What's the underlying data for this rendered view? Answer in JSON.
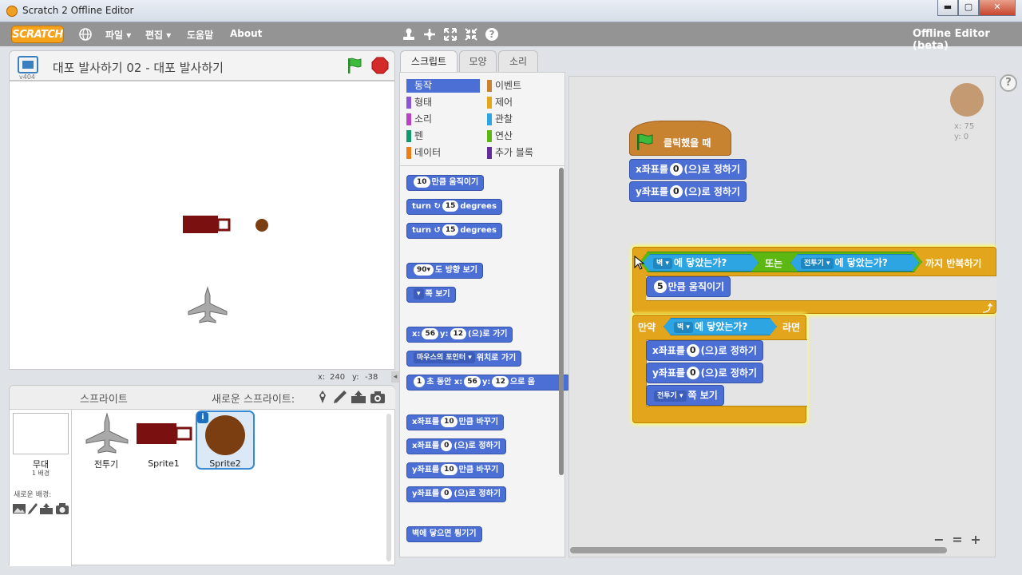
{
  "window": {
    "title": "Scratch 2 Offline Editor",
    "min": "▬",
    "max": "▢",
    "close": "✕"
  },
  "menu": {
    "logo": "SCRATCH",
    "file": "파일 ▾",
    "edit": "편집 ▾",
    "help": "도움말",
    "about": "About",
    "edition": "Offline Editor (beta)"
  },
  "stage": {
    "project_title": "대포 발사하기 02 - 대포 발사하기",
    "version": "v404",
    "mouse_x_label": "x:",
    "mouse_x": "240",
    "mouse_y_label": "y:",
    "mouse_y": "-38"
  },
  "tabs": {
    "scripts": "스크립트",
    "costumes": "모양",
    "sounds": "소리"
  },
  "categories": {
    "motion": "동작",
    "looks": "형태",
    "sound": "소리",
    "pen": "펜",
    "data": "데이터",
    "events": "이벤트",
    "control": "제어",
    "sensing": "관찰",
    "operators": "연산",
    "more": "추가 블록"
  },
  "palette": {
    "move": {
      "num": "10",
      "text": "만큼 움직이기"
    },
    "turn_cw": {
      "label": "turn",
      "icon": "↻",
      "num": "15",
      "unit": "degrees"
    },
    "turn_ccw": {
      "label": "turn",
      "icon": "↺",
      "num": "15",
      "unit": "degrees"
    },
    "point_dir": {
      "num": "90▾",
      "text": "도 방향 보기"
    },
    "point_towards": {
      "dd": "▾",
      "text": "쪽 보기"
    },
    "goto_xy": {
      "x_label": "x:",
      "x": "56",
      "y_label": "y:",
      "y": "12",
      "text": "(으)로 가기"
    },
    "goto_target": {
      "dd": "마우스의 포인터 ▾",
      "text": "위치로 가기"
    },
    "glide": {
      "num": "1",
      "t1": "초 동안 x:",
      "x": "56",
      "y_label": "y:",
      "y": "12",
      "t2": "으로 움"
    },
    "change_x": {
      "pre": "x좌표를",
      "num": "10",
      "post": "만큼 바꾸기"
    },
    "set_x": {
      "pre": "x좌표를",
      "num": "0",
      "post": "(으)로 정하기"
    },
    "change_y": {
      "pre": "y좌표를",
      "num": "10",
      "post": "만큼 바꾸기"
    },
    "set_y": {
      "pre": "y좌표를",
      "num": "0",
      "post": "(으)로 정하기"
    },
    "bounce": {
      "text": "벽에 닿으면 튕기기"
    }
  },
  "script": {
    "hat": {
      "text": "클릭했을 때"
    },
    "set_x1": {
      "pre": "x좌표를",
      "num": "0",
      "post": "(으)로 정하기"
    },
    "set_y1": {
      "pre": "y좌표를",
      "num": "0",
      "post": "(으)로 정하기"
    },
    "repeat_until": {
      "opt1": "벽 ▾",
      "touch1": "에 닿았는가?",
      "or": "또는",
      "opt2": "전투기 ▾",
      "touch2": "에 닿았는가?",
      "tail": "까지 반복하기",
      "loop_icon": "⤴"
    },
    "move5": {
      "num": "5",
      "text": "만큼 움직이기"
    },
    "if": {
      "label": "만약",
      "opt": "벽 ▾",
      "touch": "에 닿았는가?",
      "then": "라면"
    },
    "set_x2": {
      "pre": "x좌표를",
      "num": "0",
      "post": "(으)로 정하기"
    },
    "set_y2": {
      "pre": "y좌표를",
      "num": "0",
      "post": "(으)로 정하기"
    },
    "point_towards": {
      "dd": "전투기 ▾",
      "text": "쪽 보기"
    },
    "sprite_x": "x: 75",
    "sprite_y": "y: 0"
  },
  "sprites": {
    "header": "스프라이트",
    "new_sprite": "새로운 스프라이트:",
    "stage_label": "무대",
    "backdrop_count": "1 배경",
    "new_backdrop": "새로운 배경:",
    "items": [
      {
        "name": "전투기"
      },
      {
        "name": "Sprite1"
      },
      {
        "name": "Sprite2"
      }
    ],
    "info_icon": "i"
  },
  "zoom": {
    "out": "−",
    "reset": "=",
    "in": "+"
  },
  "help": "?",
  "colors": {
    "motion": "#4c6fd6",
    "control": "#e2a51b",
    "sensing": "#2ca5e2",
    "events": "#c88330",
    "cannon": "#7a1010",
    "ball": "#7a3e10"
  }
}
